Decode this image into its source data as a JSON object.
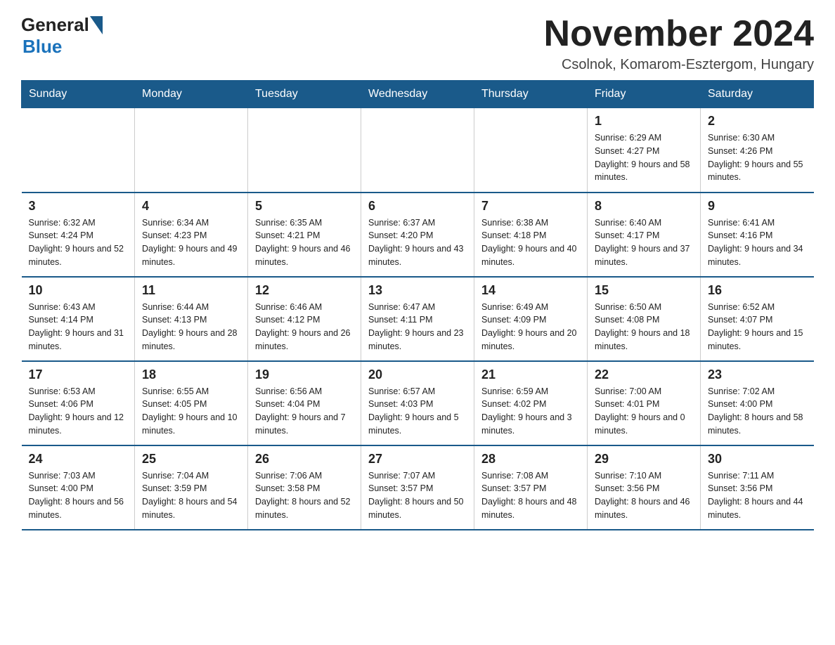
{
  "logo": {
    "general": "General",
    "blue": "Blue"
  },
  "header": {
    "month_title": "November 2024",
    "subtitle": "Csolnok, Komarom-Esztergom, Hungary"
  },
  "days_of_week": [
    "Sunday",
    "Monday",
    "Tuesday",
    "Wednesday",
    "Thursday",
    "Friday",
    "Saturday"
  ],
  "weeks": [
    [
      {
        "day": "",
        "info": ""
      },
      {
        "day": "",
        "info": ""
      },
      {
        "day": "",
        "info": ""
      },
      {
        "day": "",
        "info": ""
      },
      {
        "day": "",
        "info": ""
      },
      {
        "day": "1",
        "info": "Sunrise: 6:29 AM\nSunset: 4:27 PM\nDaylight: 9 hours and 58 minutes."
      },
      {
        "day": "2",
        "info": "Sunrise: 6:30 AM\nSunset: 4:26 PM\nDaylight: 9 hours and 55 minutes."
      }
    ],
    [
      {
        "day": "3",
        "info": "Sunrise: 6:32 AM\nSunset: 4:24 PM\nDaylight: 9 hours and 52 minutes."
      },
      {
        "day": "4",
        "info": "Sunrise: 6:34 AM\nSunset: 4:23 PM\nDaylight: 9 hours and 49 minutes."
      },
      {
        "day": "5",
        "info": "Sunrise: 6:35 AM\nSunset: 4:21 PM\nDaylight: 9 hours and 46 minutes."
      },
      {
        "day": "6",
        "info": "Sunrise: 6:37 AM\nSunset: 4:20 PM\nDaylight: 9 hours and 43 minutes."
      },
      {
        "day": "7",
        "info": "Sunrise: 6:38 AM\nSunset: 4:18 PM\nDaylight: 9 hours and 40 minutes."
      },
      {
        "day": "8",
        "info": "Sunrise: 6:40 AM\nSunset: 4:17 PM\nDaylight: 9 hours and 37 minutes."
      },
      {
        "day": "9",
        "info": "Sunrise: 6:41 AM\nSunset: 4:16 PM\nDaylight: 9 hours and 34 minutes."
      }
    ],
    [
      {
        "day": "10",
        "info": "Sunrise: 6:43 AM\nSunset: 4:14 PM\nDaylight: 9 hours and 31 minutes."
      },
      {
        "day": "11",
        "info": "Sunrise: 6:44 AM\nSunset: 4:13 PM\nDaylight: 9 hours and 28 minutes."
      },
      {
        "day": "12",
        "info": "Sunrise: 6:46 AM\nSunset: 4:12 PM\nDaylight: 9 hours and 26 minutes."
      },
      {
        "day": "13",
        "info": "Sunrise: 6:47 AM\nSunset: 4:11 PM\nDaylight: 9 hours and 23 minutes."
      },
      {
        "day": "14",
        "info": "Sunrise: 6:49 AM\nSunset: 4:09 PM\nDaylight: 9 hours and 20 minutes."
      },
      {
        "day": "15",
        "info": "Sunrise: 6:50 AM\nSunset: 4:08 PM\nDaylight: 9 hours and 18 minutes."
      },
      {
        "day": "16",
        "info": "Sunrise: 6:52 AM\nSunset: 4:07 PM\nDaylight: 9 hours and 15 minutes."
      }
    ],
    [
      {
        "day": "17",
        "info": "Sunrise: 6:53 AM\nSunset: 4:06 PM\nDaylight: 9 hours and 12 minutes."
      },
      {
        "day": "18",
        "info": "Sunrise: 6:55 AM\nSunset: 4:05 PM\nDaylight: 9 hours and 10 minutes."
      },
      {
        "day": "19",
        "info": "Sunrise: 6:56 AM\nSunset: 4:04 PM\nDaylight: 9 hours and 7 minutes."
      },
      {
        "day": "20",
        "info": "Sunrise: 6:57 AM\nSunset: 4:03 PM\nDaylight: 9 hours and 5 minutes."
      },
      {
        "day": "21",
        "info": "Sunrise: 6:59 AM\nSunset: 4:02 PM\nDaylight: 9 hours and 3 minutes."
      },
      {
        "day": "22",
        "info": "Sunrise: 7:00 AM\nSunset: 4:01 PM\nDaylight: 9 hours and 0 minutes."
      },
      {
        "day": "23",
        "info": "Sunrise: 7:02 AM\nSunset: 4:00 PM\nDaylight: 8 hours and 58 minutes."
      }
    ],
    [
      {
        "day": "24",
        "info": "Sunrise: 7:03 AM\nSunset: 4:00 PM\nDaylight: 8 hours and 56 minutes."
      },
      {
        "day": "25",
        "info": "Sunrise: 7:04 AM\nSunset: 3:59 PM\nDaylight: 8 hours and 54 minutes."
      },
      {
        "day": "26",
        "info": "Sunrise: 7:06 AM\nSunset: 3:58 PM\nDaylight: 8 hours and 52 minutes."
      },
      {
        "day": "27",
        "info": "Sunrise: 7:07 AM\nSunset: 3:57 PM\nDaylight: 8 hours and 50 minutes."
      },
      {
        "day": "28",
        "info": "Sunrise: 7:08 AM\nSunset: 3:57 PM\nDaylight: 8 hours and 48 minutes."
      },
      {
        "day": "29",
        "info": "Sunrise: 7:10 AM\nSunset: 3:56 PM\nDaylight: 8 hours and 46 minutes."
      },
      {
        "day": "30",
        "info": "Sunrise: 7:11 AM\nSunset: 3:56 PM\nDaylight: 8 hours and 44 minutes."
      }
    ]
  ]
}
